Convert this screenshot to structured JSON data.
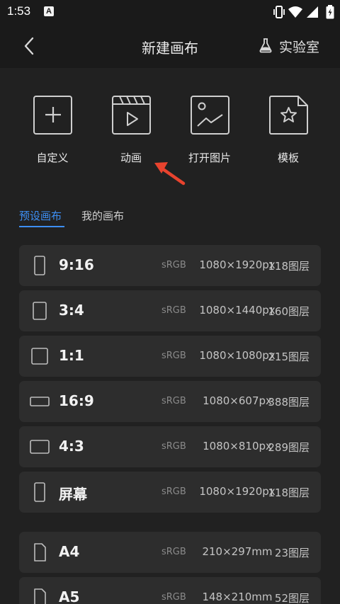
{
  "status": {
    "time": "1:53",
    "notif_letter": "A"
  },
  "header": {
    "title": "新建画布",
    "lab_label": "实验室"
  },
  "actions": [
    {
      "label": "自定义",
      "icon": "plus-icon"
    },
    {
      "label": "动画",
      "icon": "clapperboard-play-icon"
    },
    {
      "label": "打开图片",
      "icon": "image-icon"
    },
    {
      "label": "模板",
      "icon": "template-star-icon"
    }
  ],
  "tabs": [
    {
      "label": "预设画布",
      "active": true
    },
    {
      "label": "我的画布",
      "active": false
    }
  ],
  "presets": [
    {
      "name": "9:16",
      "colorspace": "sRGB",
      "size": "1080×1920px",
      "layers": "118图层",
      "icon": "portrait-tall-icon"
    },
    {
      "name": "3:4",
      "colorspace": "sRGB",
      "size": "1080×1440px",
      "layers": "160图层",
      "icon": "portrait-icon"
    },
    {
      "name": "1:1",
      "colorspace": "sRGB",
      "size": "1080×1080px",
      "layers": "215图层",
      "icon": "square-icon"
    },
    {
      "name": "16:9",
      "colorspace": "sRGB",
      "size": "1080×607px",
      "layers": "388图层",
      "icon": "landscape-wide-icon"
    },
    {
      "name": "4:3",
      "colorspace": "sRGB",
      "size": "1080×810px",
      "layers": "289图层",
      "icon": "landscape-icon"
    },
    {
      "name": "屏幕",
      "colorspace": "sRGB",
      "size": "1080×1920px",
      "layers": "118图层",
      "icon": "phone-screen-icon"
    }
  ],
  "papers": [
    {
      "name": "A4",
      "colorspace": "sRGB",
      "size": "210×297mm",
      "layers": "23图层",
      "icon": "document-icon"
    },
    {
      "name": "A5",
      "colorspace": "sRGB",
      "size": "148×210mm",
      "layers": "52图层",
      "icon": "document-icon"
    }
  ],
  "colors": {
    "accent": "#3d8ff5",
    "arrow": "#e8432e",
    "row_bg": "#2d2d2d",
    "bg": "#212121",
    "header_bg": "#1a1a1a"
  }
}
